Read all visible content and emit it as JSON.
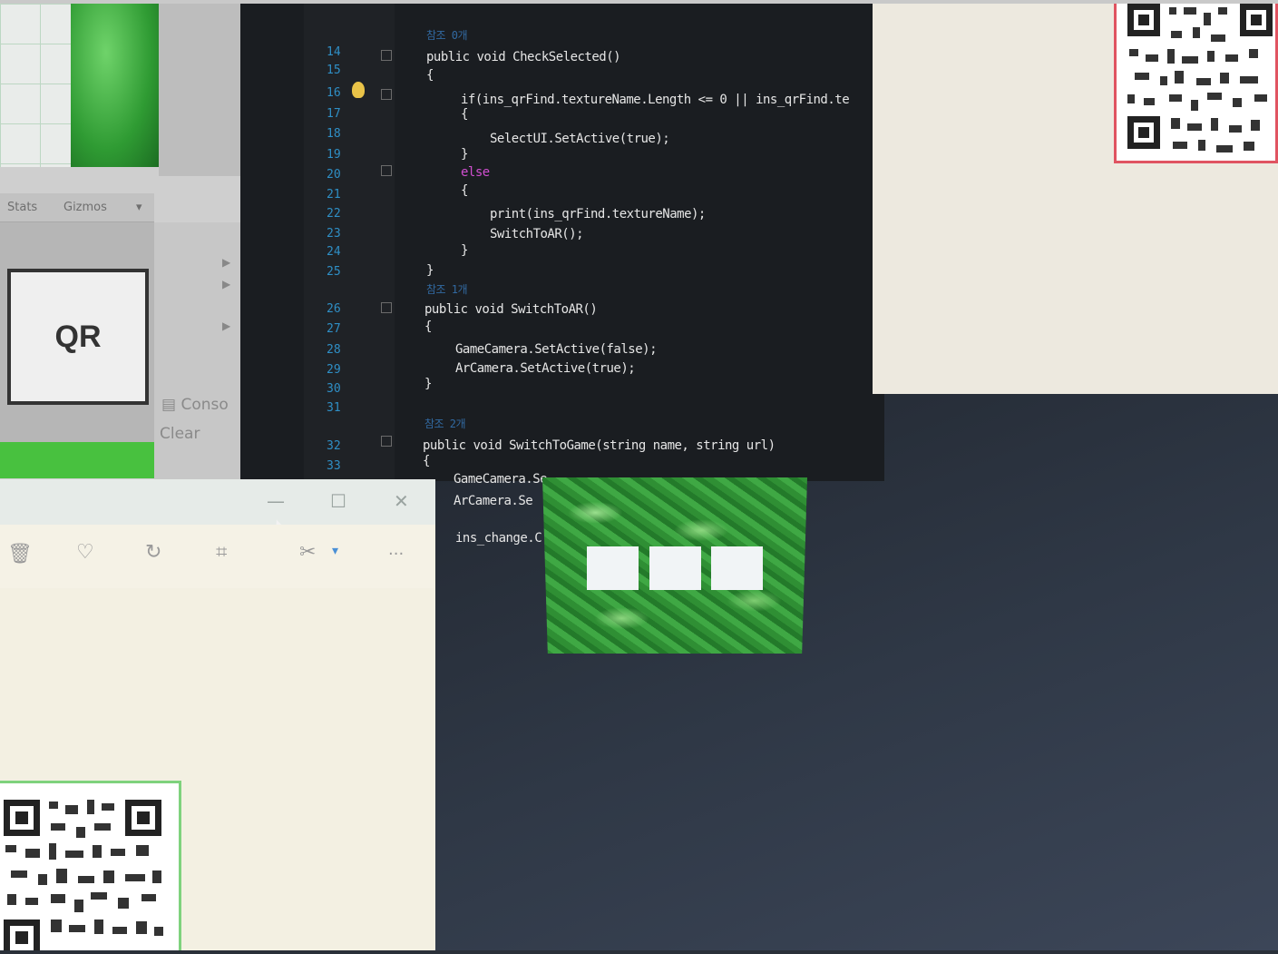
{
  "unity": {
    "toolbar_stats": "Stats",
    "toolbar_gizmos": "Gizmos",
    "qr_target_label": "QR",
    "console_tab": "Conso",
    "clear_button": "Clear"
  },
  "editor": {
    "line_numbers": [
      "14",
      "15",
      "16",
      "17",
      "18",
      "19",
      "20",
      "21",
      "22",
      "23",
      "24",
      "25",
      "26",
      "27",
      "28",
      "29",
      "30",
      "31",
      "32",
      "33"
    ],
    "lines": [
      {
        "text": "참조 0개",
        "kind": "ref"
      },
      {
        "text": "public void CheckSelected()",
        "kind": "sig"
      },
      {
        "text": "{",
        "kind": "plain"
      },
      {
        "text": "if(ins_qrFind.textureName.Length <= 0 || ins_qrFind.te",
        "kind": "plain"
      },
      {
        "text": "{",
        "kind": "plain"
      },
      {
        "text": "SelectUI.SetActive(true);",
        "kind": "plain"
      },
      {
        "text": "}",
        "kind": "plain"
      },
      {
        "text": "else",
        "kind": "else"
      },
      {
        "text": "{",
        "kind": "plain"
      },
      {
        "text": "print(ins_qrFind.textureName);",
        "kind": "plain"
      },
      {
        "text": "SwitchToAR();",
        "kind": "plain"
      },
      {
        "text": "}",
        "kind": "plain"
      },
      {
        "text": "}",
        "kind": "plain"
      },
      {
        "text": "참조 1개",
        "kind": "ref"
      },
      {
        "text": "public void SwitchToAR()",
        "kind": "sig"
      },
      {
        "text": "{",
        "kind": "plain"
      },
      {
        "text": "GameCamera.SetActive(false);",
        "kind": "plain"
      },
      {
        "text": "ArCamera.SetActive(true);",
        "kind": "plain"
      },
      {
        "text": "}",
        "kind": "plain"
      },
      {
        "text": "참조 2개",
        "kind": "ref"
      },
      {
        "text": "public void SwitchToGame(string name, string url)",
        "kind": "sig"
      },
      {
        "text": "{",
        "kind": "plain"
      },
      {
        "text": "GameCamera.Se",
        "kind": "plain"
      },
      {
        "text": "ArCamera.Se",
        "kind": "plain"
      },
      {
        "text": "ins_change.C",
        "kind": "plain"
      }
    ]
  },
  "photos": {
    "minimize_glyph": "—",
    "maximize_glyph": "☐",
    "close_glyph": "✕",
    "toolbar_more": "···"
  },
  "ar_overlay": {
    "slot_count": 3,
    "texture": "green leaves"
  },
  "colors": {
    "editor_bg": "#1a1d21",
    "line_number": "#2f8fc6",
    "keyword": "#3c8ad8",
    "unity_green": "#48c13f",
    "qr_frame_red": "#e05461",
    "qr_frame_green": "#7fd27d"
  }
}
